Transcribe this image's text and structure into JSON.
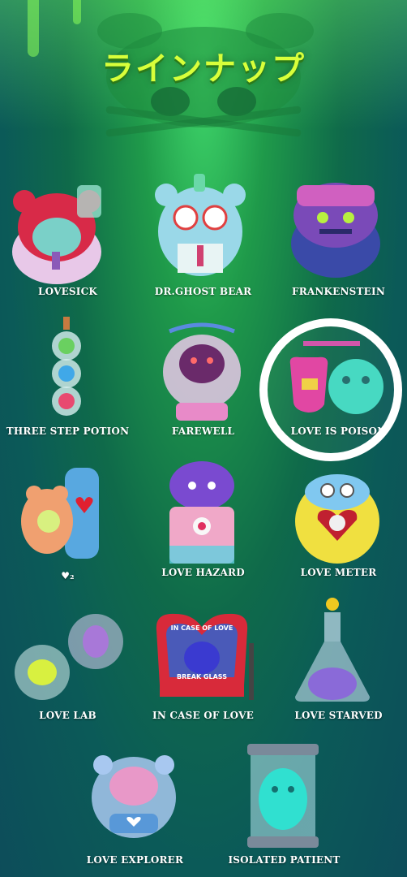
{
  "title": "ラインナップ",
  "items": [
    {
      "label": "LOVESICK"
    },
    {
      "label": "DR.GHOST BEAR"
    },
    {
      "label": "FRANKENSTEIN"
    },
    {
      "label": "THREE STEP POTION"
    },
    {
      "label": "FAREWELL"
    },
    {
      "label": "LOVE IS POISON"
    },
    {
      "label": "♥₂"
    },
    {
      "label": "LOVE HAZARD"
    },
    {
      "label": "LOVE METER"
    },
    {
      "label": "LOVE LAB"
    },
    {
      "label": "IN CASE OF LOVE"
    },
    {
      "label": "LOVE STARVED"
    },
    {
      "label": "LOVE EXPLORER"
    },
    {
      "label": "ISOLATED PATIENT"
    }
  ],
  "figure_text": {
    "case_top": "IN CASE OF LOVE",
    "case_bottom": "BREAK GLASS"
  },
  "highlighted_item": "LOVE IS POISON",
  "colors": {
    "title": "#d8ff3a",
    "background_top": "#3fd66a",
    "background_bottom": "#0d4d5a",
    "highlight_ring": "#ffffff"
  }
}
